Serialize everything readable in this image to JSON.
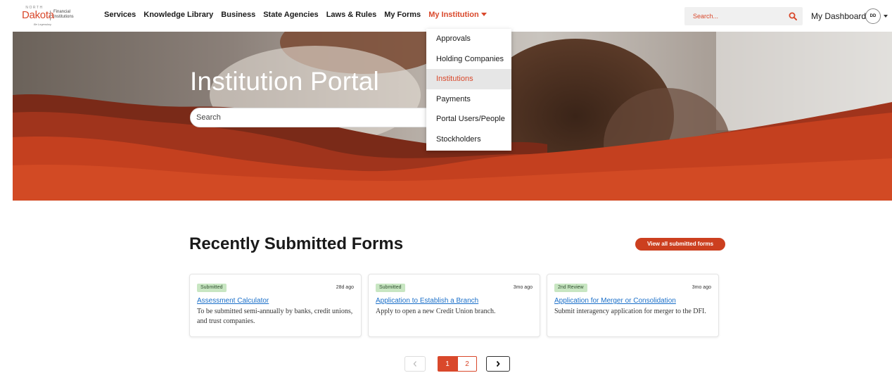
{
  "brand": {
    "state_small": "NORTH",
    "state_name": "Dakota",
    "tagline": "Be Legendary.",
    "department": "Financial\nInstitutions"
  },
  "nav": {
    "items": [
      {
        "label": "Services"
      },
      {
        "label": "Knowledge Library"
      },
      {
        "label": "Business"
      },
      {
        "label": "State Agencies"
      },
      {
        "label": "Laws & Rules"
      },
      {
        "label": "My Forms"
      },
      {
        "label": "My Institution"
      }
    ]
  },
  "header_search": {
    "placeholder": "Search..."
  },
  "user": {
    "dashboard_label": "My Dashboard",
    "initials": "DD"
  },
  "dropdown": {
    "items": [
      {
        "label": "Approvals"
      },
      {
        "label": "Holding Companies"
      },
      {
        "label": "Institutions"
      },
      {
        "label": "Payments"
      },
      {
        "label": "Portal Users/People"
      },
      {
        "label": "Stockholders"
      }
    ]
  },
  "hero": {
    "title": "Institution Portal",
    "search_placeholder": "Search"
  },
  "forms": {
    "title": "Recently Submitted Forms",
    "view_all_label": "View all submitted forms",
    "cards": [
      {
        "status": "Submitted",
        "ago": "28d ago",
        "title": "Assessment Calculator",
        "description": "To be submitted semi-annually by banks, credit unions, and trust companies."
      },
      {
        "status": "Submitted",
        "ago": "3mo ago",
        "title": "Application to Establish a Branch",
        "description": "Apply to open a new Credit Union branch."
      },
      {
        "status": "2nd Review",
        "ago": "3mo ago",
        "title": "Application for Merger or Consolidation",
        "description": "Submit interagency application for merger to the DFI."
      }
    ]
  },
  "pagination": {
    "pages": [
      "1",
      "2"
    ],
    "current": "1"
  },
  "colors": {
    "accent": "#d9482b",
    "badge_green": "#c8e6c2",
    "link": "#1a6fc9"
  }
}
